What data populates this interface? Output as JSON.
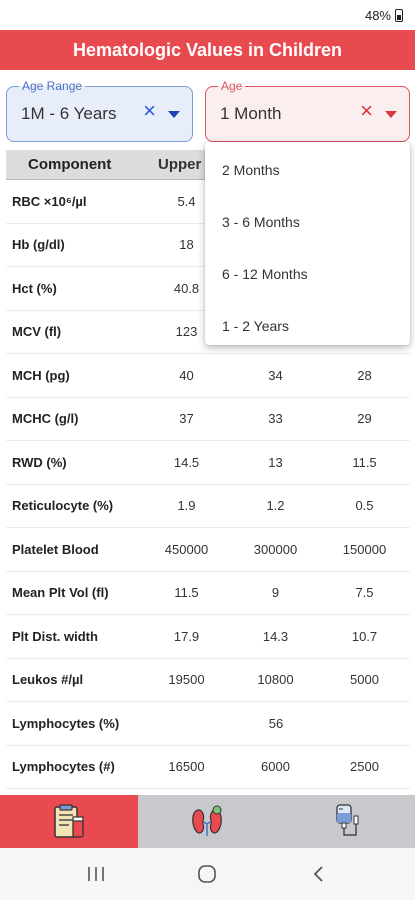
{
  "status": {
    "battery": "48%"
  },
  "app": {
    "title": "Hematologic Values in Children"
  },
  "age_range_select": {
    "label": "Age Range",
    "value": "1M - 6 Years",
    "clear": "×"
  },
  "age_select": {
    "label": "Age",
    "value": "1 Month",
    "clear": "×"
  },
  "dropdown": {
    "options": [
      "2 Months",
      "3 - 6 Months",
      "6 - 12 Months",
      "1 - 2 Years"
    ]
  },
  "table": {
    "headers": [
      "Component",
      "Upper"
    ],
    "rows": [
      {
        "name": "RBC ×10⁶/µl",
        "v": [
          "5.4",
          "",
          ""
        ]
      },
      {
        "name": "Hb (g/dl)",
        "v": [
          "18",
          "",
          ""
        ]
      },
      {
        "name": "Hct (%)",
        "v": [
          "40.8",
          "",
          ""
        ]
      },
      {
        "name": "MCV (fl)",
        "v": [
          "123",
          "",
          ""
        ]
      },
      {
        "name": "MCH (pg)",
        "v": [
          "40",
          "34",
          "28"
        ]
      },
      {
        "name": "MCHC (g/l)",
        "v": [
          "37",
          "33",
          "29"
        ]
      },
      {
        "name": "RWD (%)",
        "v": [
          "14.5",
          "13",
          "11.5"
        ]
      },
      {
        "name": "Reticulocyte (%)",
        "v": [
          "1.9",
          "1.2",
          "0.5"
        ]
      },
      {
        "name": "Platelet Blood",
        "v": [
          "450000",
          "300000",
          "150000"
        ]
      },
      {
        "name": "Mean Plt Vol (fl)",
        "v": [
          "11.5",
          "9",
          "7.5"
        ]
      },
      {
        "name": "Plt Dist. width",
        "v": [
          "17.9",
          "14.3",
          "10.7"
        ]
      },
      {
        "name": "Leukos #/µl",
        "v": [
          "19500",
          "10800",
          "5000"
        ]
      },
      {
        "name": "Lymphocytes (%)",
        "merged": "56"
      },
      {
        "name": "Lymphocytes (#)",
        "v": [
          "16500",
          "6000",
          "2500"
        ]
      }
    ]
  },
  "bottom_nav": {
    "items": [
      "lab-report-icon",
      "kidney-icon",
      "iv-drip-icon"
    ],
    "active": 0
  },
  "colors": {
    "accent": "#e94a4f",
    "select_blue": "#7a9bd6",
    "nav_inactive": "#c8c9cc"
  }
}
